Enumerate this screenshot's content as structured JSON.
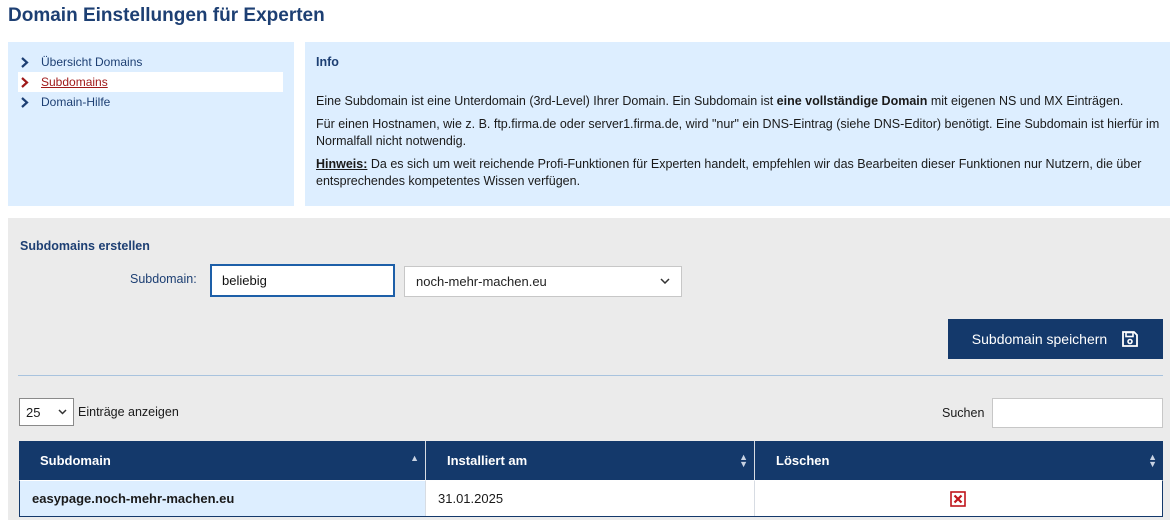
{
  "page": {
    "title": "Domain Einstellungen für Experten"
  },
  "sidebar": {
    "items": [
      {
        "label": "Übersicht Domains",
        "active": false
      },
      {
        "label": "Subdomains",
        "active": true
      },
      {
        "label": "Domain-Hilfe",
        "active": false
      }
    ]
  },
  "info": {
    "title": "Info",
    "p1_pre": "Eine Subdomain ist eine Unterdomain (3rd-Level) Ihrer Domain. Ein Subdomain ist ",
    "p1_bold": "eine vollständige Domain",
    "p1_post": " mit eigenen NS und MX Einträgen.",
    "p2": "Für einen Hostnamen, wie z. B. ftp.firma.de oder server1.firma.de, wird \"nur\" ein DNS-Eintrag (siehe DNS-Editor) benötigt. Eine Subdomain ist hierfür im Normalfall nicht notwendig.",
    "hint_label": "Hinweis:",
    "hint_text": " Da es sich um weit reichende Profi-Funktionen für Experten handelt, empfehlen wir das Bearbeiten dieser Funktionen nur Nutzern, die über entsprechendes kompetentes Wissen verfügen."
  },
  "create": {
    "title": "Subdomains erstellen",
    "subdomain_label": "Subdomain:",
    "subdomain_value": "beliebig",
    "domain_selected": "noch-mehr-machen.eu",
    "save_label": "Subdomain speichern"
  },
  "table_controls": {
    "page_length": "25",
    "page_length_label": "Einträge anzeigen",
    "search_label": "Suchen",
    "search_value": ""
  },
  "table": {
    "columns": [
      "Subdomain",
      "Installiert am",
      "Löschen"
    ],
    "rows": [
      {
        "subdomain": "easypage.noch-mehr-machen.eu",
        "installed": "31.01.2025"
      }
    ]
  },
  "colors": {
    "navy": "#14396b",
    "light_blue": "#ddeeff",
    "panel_gray": "#ebebeb",
    "active_red": "#a01a1a",
    "delete_red": "#c0161c"
  }
}
